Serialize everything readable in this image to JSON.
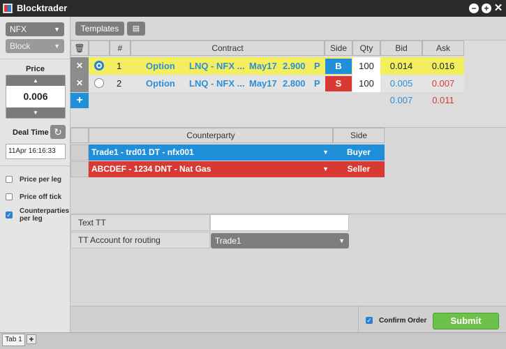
{
  "window": {
    "title": "Blocktrader"
  },
  "sidebar": {
    "exchange": "NFX",
    "order_type": "Block",
    "price_label": "Price",
    "price_value": "0.006",
    "deal_time_label": "Deal Time",
    "deal_time_value": "11Apr 16:16:33",
    "options": [
      {
        "label": "Price per leg",
        "checked": false
      },
      {
        "label": "Price off tick",
        "checked": false
      },
      {
        "label": "Counterparties per leg",
        "checked": true
      }
    ]
  },
  "toolbar": {
    "templates_label": "Templates"
  },
  "legs": {
    "headers": {
      "num": "#",
      "contract": "Contract",
      "side": "Side",
      "qty": "Qty",
      "bid": "Bid",
      "ask": "Ask"
    },
    "rows": [
      {
        "num": "1",
        "type": "Option",
        "contract": "LNQ - NFX ...",
        "expiry": "May17",
        "strike": "2.900",
        "pc": "P",
        "side": "B",
        "qty": "100",
        "bid": "0.014",
        "ask": "0.016",
        "selected": true
      },
      {
        "num": "2",
        "type": "Option",
        "contract": "LNQ - NFX ...",
        "expiry": "May17",
        "strike": "2.800",
        "pc": "P",
        "side": "S",
        "qty": "100",
        "bid": "0.005",
        "ask": "0.007",
        "selected": false
      }
    ],
    "total": {
      "bid": "0.007",
      "ask": "0.011"
    }
  },
  "counterparties": {
    "headers": {
      "counterparty": "Counterparty",
      "side": "Side"
    },
    "rows": [
      {
        "name": "Trade1 - trd01 DT - nfx001",
        "side": "Buyer"
      },
      {
        "name": "ABCDEF - 1234 DNT - Nat Gas",
        "side": "Seller"
      }
    ]
  },
  "routing": {
    "text_tt_label": "Text TT",
    "text_tt_value": "",
    "account_label": "TT Account for routing",
    "account_value": "Trade1"
  },
  "footer": {
    "confirm_label": "Confirm Order",
    "confirm_checked": true,
    "submit_label": "Submit"
  },
  "tabs": [
    {
      "label": "Tab 1"
    }
  ],
  "colors": {
    "buy": "#1e8fd8",
    "sell": "#d83a33",
    "selected_row": "#f2ee5e",
    "submit": "#6cc14a",
    "annotation_arrow": "#e84a2a"
  }
}
